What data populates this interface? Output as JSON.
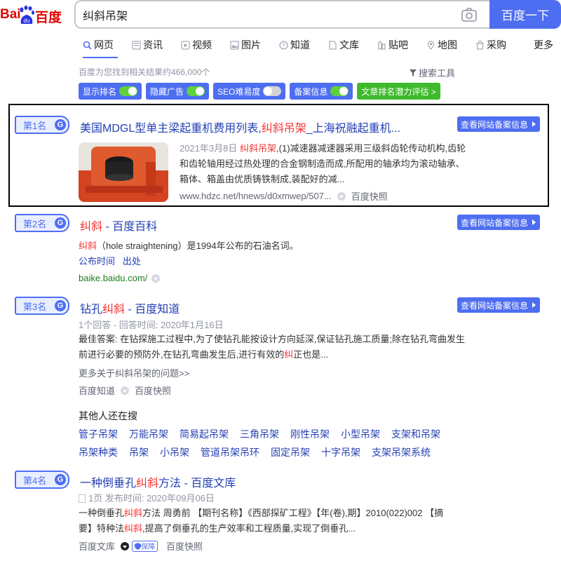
{
  "header": {
    "logo_left": "Bai",
    "logo_right": "百度",
    "search_value": "纠斜吊架",
    "search_button": "百度一下"
  },
  "tabs": [
    {
      "label": "网页",
      "icon": "search-icon"
    },
    {
      "label": "资讯",
      "icon": "news-icon"
    },
    {
      "label": "视频",
      "icon": "video-icon"
    },
    {
      "label": "图片",
      "icon": "image-icon"
    },
    {
      "label": "知道",
      "icon": "question-icon"
    },
    {
      "label": "文库",
      "icon": "doc-icon"
    },
    {
      "label": "贴吧",
      "icon": "tieba-icon"
    },
    {
      "label": "地图",
      "icon": "map-icon"
    },
    {
      "label": "采购",
      "icon": "cart-icon"
    }
  ],
  "tab_more": "更多",
  "result_count": "百度为您找到相关结果约466,000个",
  "search_tools": "搜索工具",
  "toggles": [
    {
      "label": "显示排名",
      "on": true
    },
    {
      "label": "隐藏广告",
      "on": true
    },
    {
      "label": "SEO难易度",
      "on": false
    },
    {
      "label": "备案信息",
      "on": true
    }
  ],
  "toggle_green": "文章排名潜力评估 >",
  "beian_label": "查看网站备案信息",
  "results": [
    {
      "rank": "第1名",
      "badge": "G",
      "title_a": "美国MDGL型单主梁起重机费用列表,",
      "title_red": "纠斜吊架",
      "title_b": "_上海祝融起重机...",
      "date": "2021年3月8日",
      "abs_red": "纠斜吊架",
      "abs_1": ",(1)减速器减速器采用三级斜齿轮传动机构,齿轮",
      "abs_2": "和齿轮轴用经过热处理的合金钢制造而成,所配用的轴承均为滚动轴承、",
      "abs_3": "箱体、箱盖由优质铸铁制成,装配好的减...",
      "url": "www.hdzc.net/hnews/d0xmwep/507...",
      "snapshot": "百度快照"
    },
    {
      "rank": "第2名",
      "badge": "G",
      "title_red": "纠斜",
      "title_b": " - 百度百科",
      "abs_red": "纠斜",
      "abs_1": "（hole straightening）是1994年公布的石油名词。",
      "link_1": "公布时间",
      "link_2": "出处",
      "url": "baike.baidu.com/"
    },
    {
      "rank": "第3名",
      "badge": "G",
      "title_a": "钻孔",
      "title_red": "纠斜",
      "title_b": " - 百度知道",
      "meta": "1个回答 - 回答时间: 2020年1月16日",
      "abs_1": "最佳答案: 在钻探施工过程中,为了使钻孔能按设计方向延深,保证钻孔施工质量;除在钻孔弯曲发生",
      "abs_2a": "前进行必要的预防外,在钻孔弯曲发生后,进行有效的",
      "abs_red": "纠",
      "abs_2b": "正也是...",
      "more": "更多关于纠斜吊架的问题>>",
      "source": "百度知道",
      "snapshot": "百度快照"
    },
    {
      "rank": "第4名",
      "badge": "G",
      "title_a": "一种倒垂孔",
      "title_red": "纠斜",
      "title_b": "方法 - 百度文库",
      "meta": "1页 发布时间: 2020年09月06日",
      "abs_1a": "一种倒垂孔",
      "abs_red1": "纠斜",
      "abs_1b": "方法 周勇前 【期刊名称】《西部探矿工程》【年(卷),期】2010(022)002 【摘",
      "abs_2a": "要】特种法",
      "abs_red2": "纠斜",
      "abs_2b": ",提高了倒垂孔的生产效率和工程质量,实现了倒垂孔...",
      "source": "百度文库",
      "shield": "保障",
      "snapshot": "百度快照"
    }
  ],
  "others": {
    "title": "其他人还在搜",
    "row1": [
      "管子吊架",
      "万能吊架",
      "简易起吊架",
      "三角吊架",
      "刚性吊架",
      "小型吊架",
      "支架和吊架"
    ],
    "row2": [
      "吊架种类",
      "吊架",
      "小吊架",
      "管道吊架吊环",
      "固定吊架",
      "十字吊架",
      "支架吊架系统"
    ]
  }
}
